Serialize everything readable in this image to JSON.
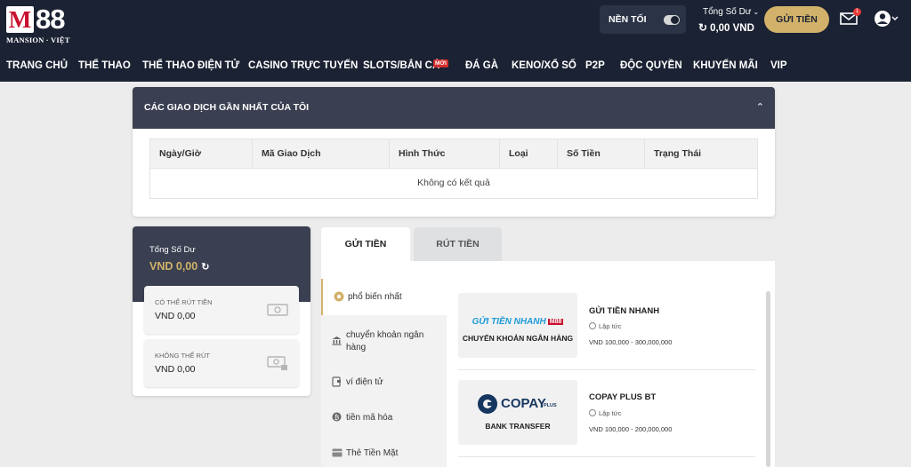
{
  "logo": {
    "mark": "M",
    "num": "88",
    "sub": "MANSION · VIỆT"
  },
  "header": {
    "dark_mode_label": "NỀN TỐI",
    "balance_title": "Tổng Số Dư",
    "balance_value": "0,00 VND",
    "deposit_label": "GỬI TIỀN",
    "mail_count": "1"
  },
  "nav": {
    "items": [
      "TRANG CHỦ",
      "THỂ THAO",
      "THỂ THAO ĐIỆN TỬ",
      "CASINO TRỰC TUYẾN",
      "SLOTS/BẮN CÁ",
      "ĐÁ GÀ",
      "KENO/XỔ SỐ",
      "P2P",
      "ĐỘC QUYỀN",
      "KHUYẾN MÃI",
      "VIP"
    ],
    "badge": "MỚI"
  },
  "transactions": {
    "title": "CÁC GIAO DỊCH GẦN NHẤT CỦA TÔI",
    "columns": [
      "Ngày/Giờ",
      "Mã Giao Dịch",
      "Hình Thức",
      "Loại",
      "Số Tiền",
      "Trạng Thái"
    ],
    "empty_text": "Không có kết quả"
  },
  "balance_panel": {
    "label": "Tổng Số Dư",
    "value": "VND 0,00",
    "withdrawable_label": "CÓ THỂ RÚT TIỀN",
    "withdrawable_value": "VND 0,00",
    "non_withdrawable_label": "KHÔNG THỂ RÚT",
    "non_withdrawable_value": "VND 0,00"
  },
  "tabs": {
    "deposit": "GỬI TIỀN",
    "withdraw": "RÚT TIỀN"
  },
  "pay_sidebar": {
    "items": [
      "phổ biến nhất",
      "chuyển khoản ngân hàng",
      "ví điện tử",
      "tiền mã hóa",
      "Thẻ Tiền Mặt"
    ]
  },
  "methods": [
    {
      "card_logo_text": "GỬI TIỀN NHANH",
      "card_logo_brand": "M88",
      "card_caption": "CHUYỂN KHOẢN NGÂN HÀNG",
      "name": "GỬI TIỀN NHANH",
      "speed": "Lập tức",
      "range": "VND 100,000 - 300,000,000"
    },
    {
      "card_logo_text": "COPAY",
      "card_logo_brand": "PLUS",
      "card_caption": "BANK TRANSFER",
      "name": "COPAY PLUS BT",
      "speed": "Lập tức",
      "range": "VND 100,000 - 200,000,000"
    }
  ],
  "colors": {
    "header_bg": "#1b2233",
    "gold": "#d2b26a",
    "panel_dark": "#3a4051",
    "badge_red": "#d62d2d"
  }
}
